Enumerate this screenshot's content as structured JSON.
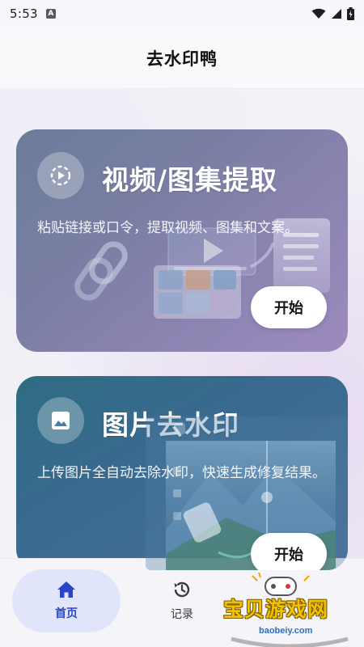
{
  "status_bar": {
    "time": "5:53",
    "notification_icon": "a-badge-icon"
  },
  "app_bar": {
    "title": "去水印鸭"
  },
  "cards": [
    {
      "icon": "play-circle-icon",
      "title": "视频/图集提取",
      "description": "粘贴链接或口令，提取视频、图集和文案。",
      "button_label": "开始"
    },
    {
      "icon": "image-icon",
      "title": "图片去水印",
      "description": "上传图片全自动去除水印，快速生成修复结果。",
      "button_label": "开始"
    }
  ],
  "bottom_nav": {
    "items": [
      {
        "label": "首页",
        "icon": "home-icon",
        "active": true
      },
      {
        "label": "记录",
        "icon": "history-icon",
        "active": false
      }
    ]
  },
  "watermark": {
    "text": "宝贝游戏网",
    "url": "baobeiy.com"
  },
  "colors": {
    "accent": "#2a45c8",
    "nav_active_bg": "#e1e5fb"
  }
}
